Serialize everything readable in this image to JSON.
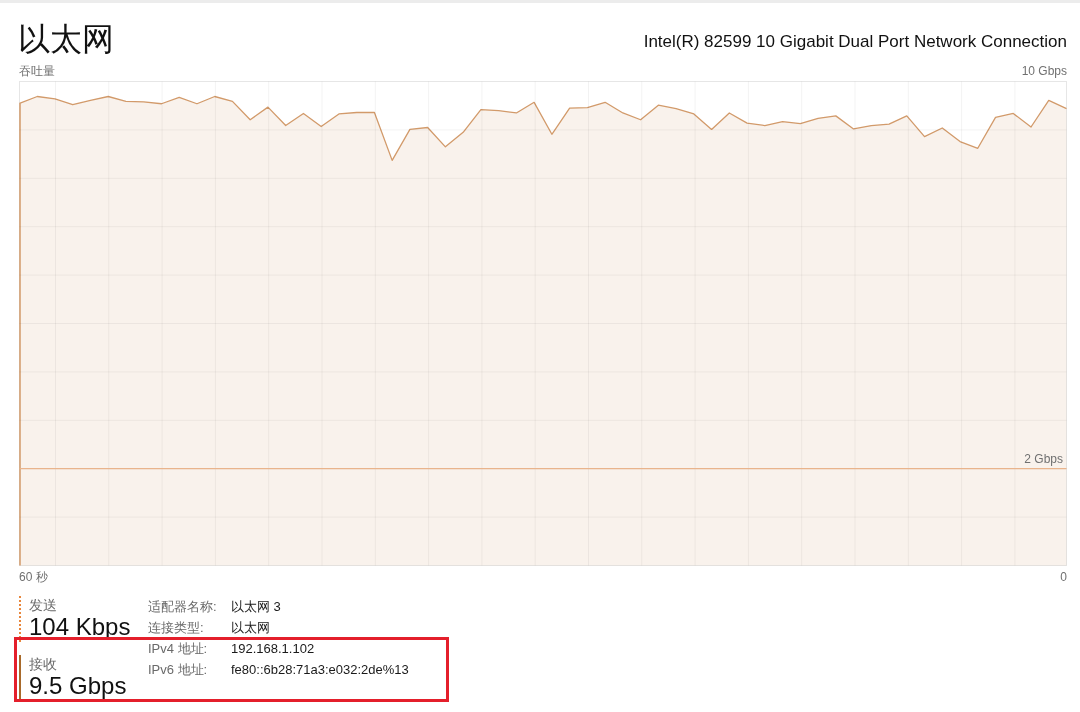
{
  "header": {
    "title": "以太网",
    "adapter_model": "Intel(R) 82599 10 Gigabit Dual Port Network Connection"
  },
  "throughput_graph": {
    "ylabel": "吞吐量",
    "max_label": "10 Gbps",
    "scale_line_label": "2 Gbps",
    "time_span_label": "60 秒",
    "end_label": "0"
  },
  "stats": [
    {
      "kind": "send",
      "label": "发送",
      "value": "104 Kbps"
    },
    {
      "kind": "receive",
      "label": "接收",
      "value": "9.5 Gbps"
    }
  ],
  "details": [
    {
      "label": "适配器名称:",
      "value": "以太网 3"
    },
    {
      "label": "连接类型:",
      "value": "以太网"
    },
    {
      "label": "IPv4 地址:",
      "value": "192.168.1.102"
    },
    {
      "label": "IPv6 地址:",
      "value": "fe80::6b28:71a3:e032:2de%13"
    }
  ],
  "annotation": {
    "kind": "highlight_box"
  }
}
